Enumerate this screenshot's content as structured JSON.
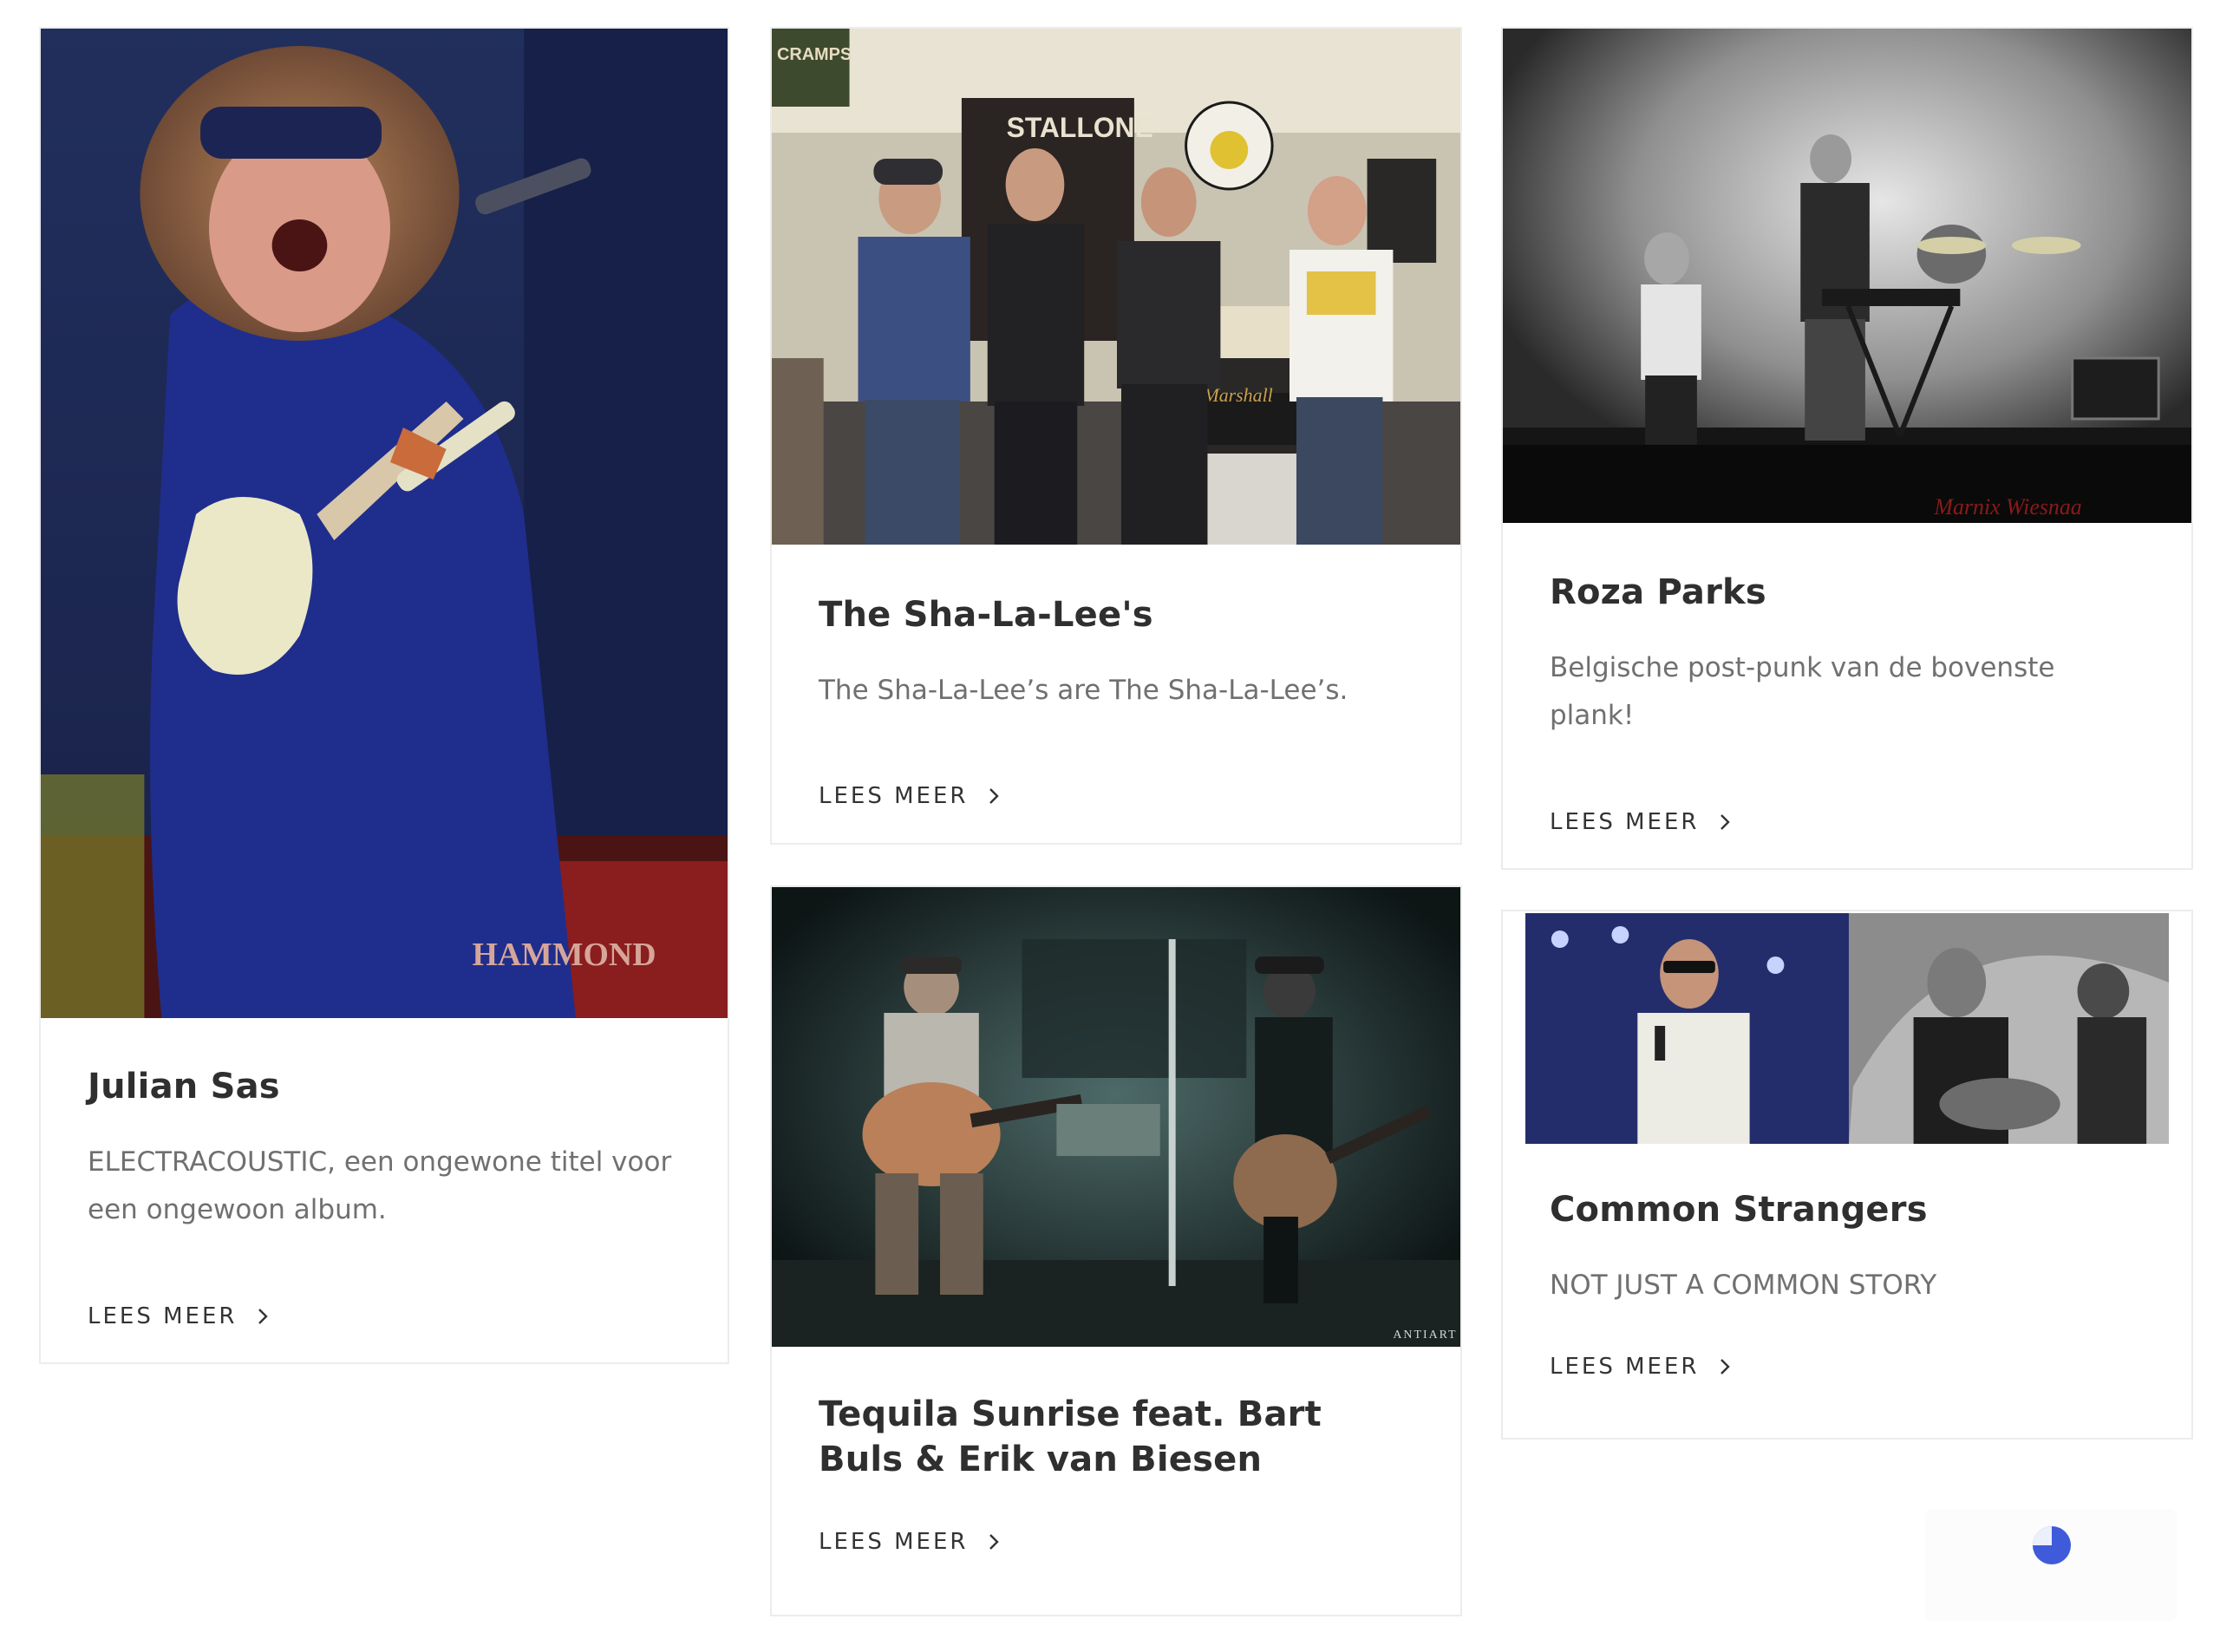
{
  "cards": [
    {
      "title": "Julian Sas",
      "excerpt": "ELECTRACOUSTIC, een ongewone titel voor een ongewoon album.",
      "link": "LEES MEER",
      "image_alt": "Guitarist with long curly hair and headband playing a cream electric guitar on stage in blue light, Hammond organ in background"
    },
    {
      "title": "The Sha-La-Lee's",
      "excerpt": "The Sha-La-Lee’s are The Sha-La-Lee’s.",
      "link": "LEES MEER",
      "image_alt": "Four band members standing in a rehearsal room with Marshall amplifier, STALLONE poster and CRAMPS sign"
    },
    {
      "title": "Roza Parks",
      "excerpt": "Belgische post-punk van de bovenste plank!",
      "link": "LEES MEER",
      "image_alt": "Black and white photo of band performing on smoky stage with keyboards and drums"
    },
    {
      "title": "Tequila Sunrise feat. Bart Buls & Erik van Biesen",
      "excerpt": "",
      "link": "LEES MEER",
      "image_alt": "Dark teal-toned photo of musicians with acoustic and hollow-body guitars on a small stage",
      "image_watermark": "ANTIART"
    },
    {
      "title": "Common Strangers",
      "excerpt": "NOT JUST A COMMON STORY",
      "link": "LEES MEER",
      "image_alt": "Split image: singer in white shirt with sunglasses at microphone, and black and white guitarist with drummer"
    }
  ],
  "icons": {
    "chevron": "chevron-right-icon",
    "loader": "loading-spinner-icon"
  },
  "colors": {
    "title": "#2f2f2f",
    "excerpt": "#707070",
    "border": "#ececec",
    "spinner": "#3f5bd9"
  }
}
